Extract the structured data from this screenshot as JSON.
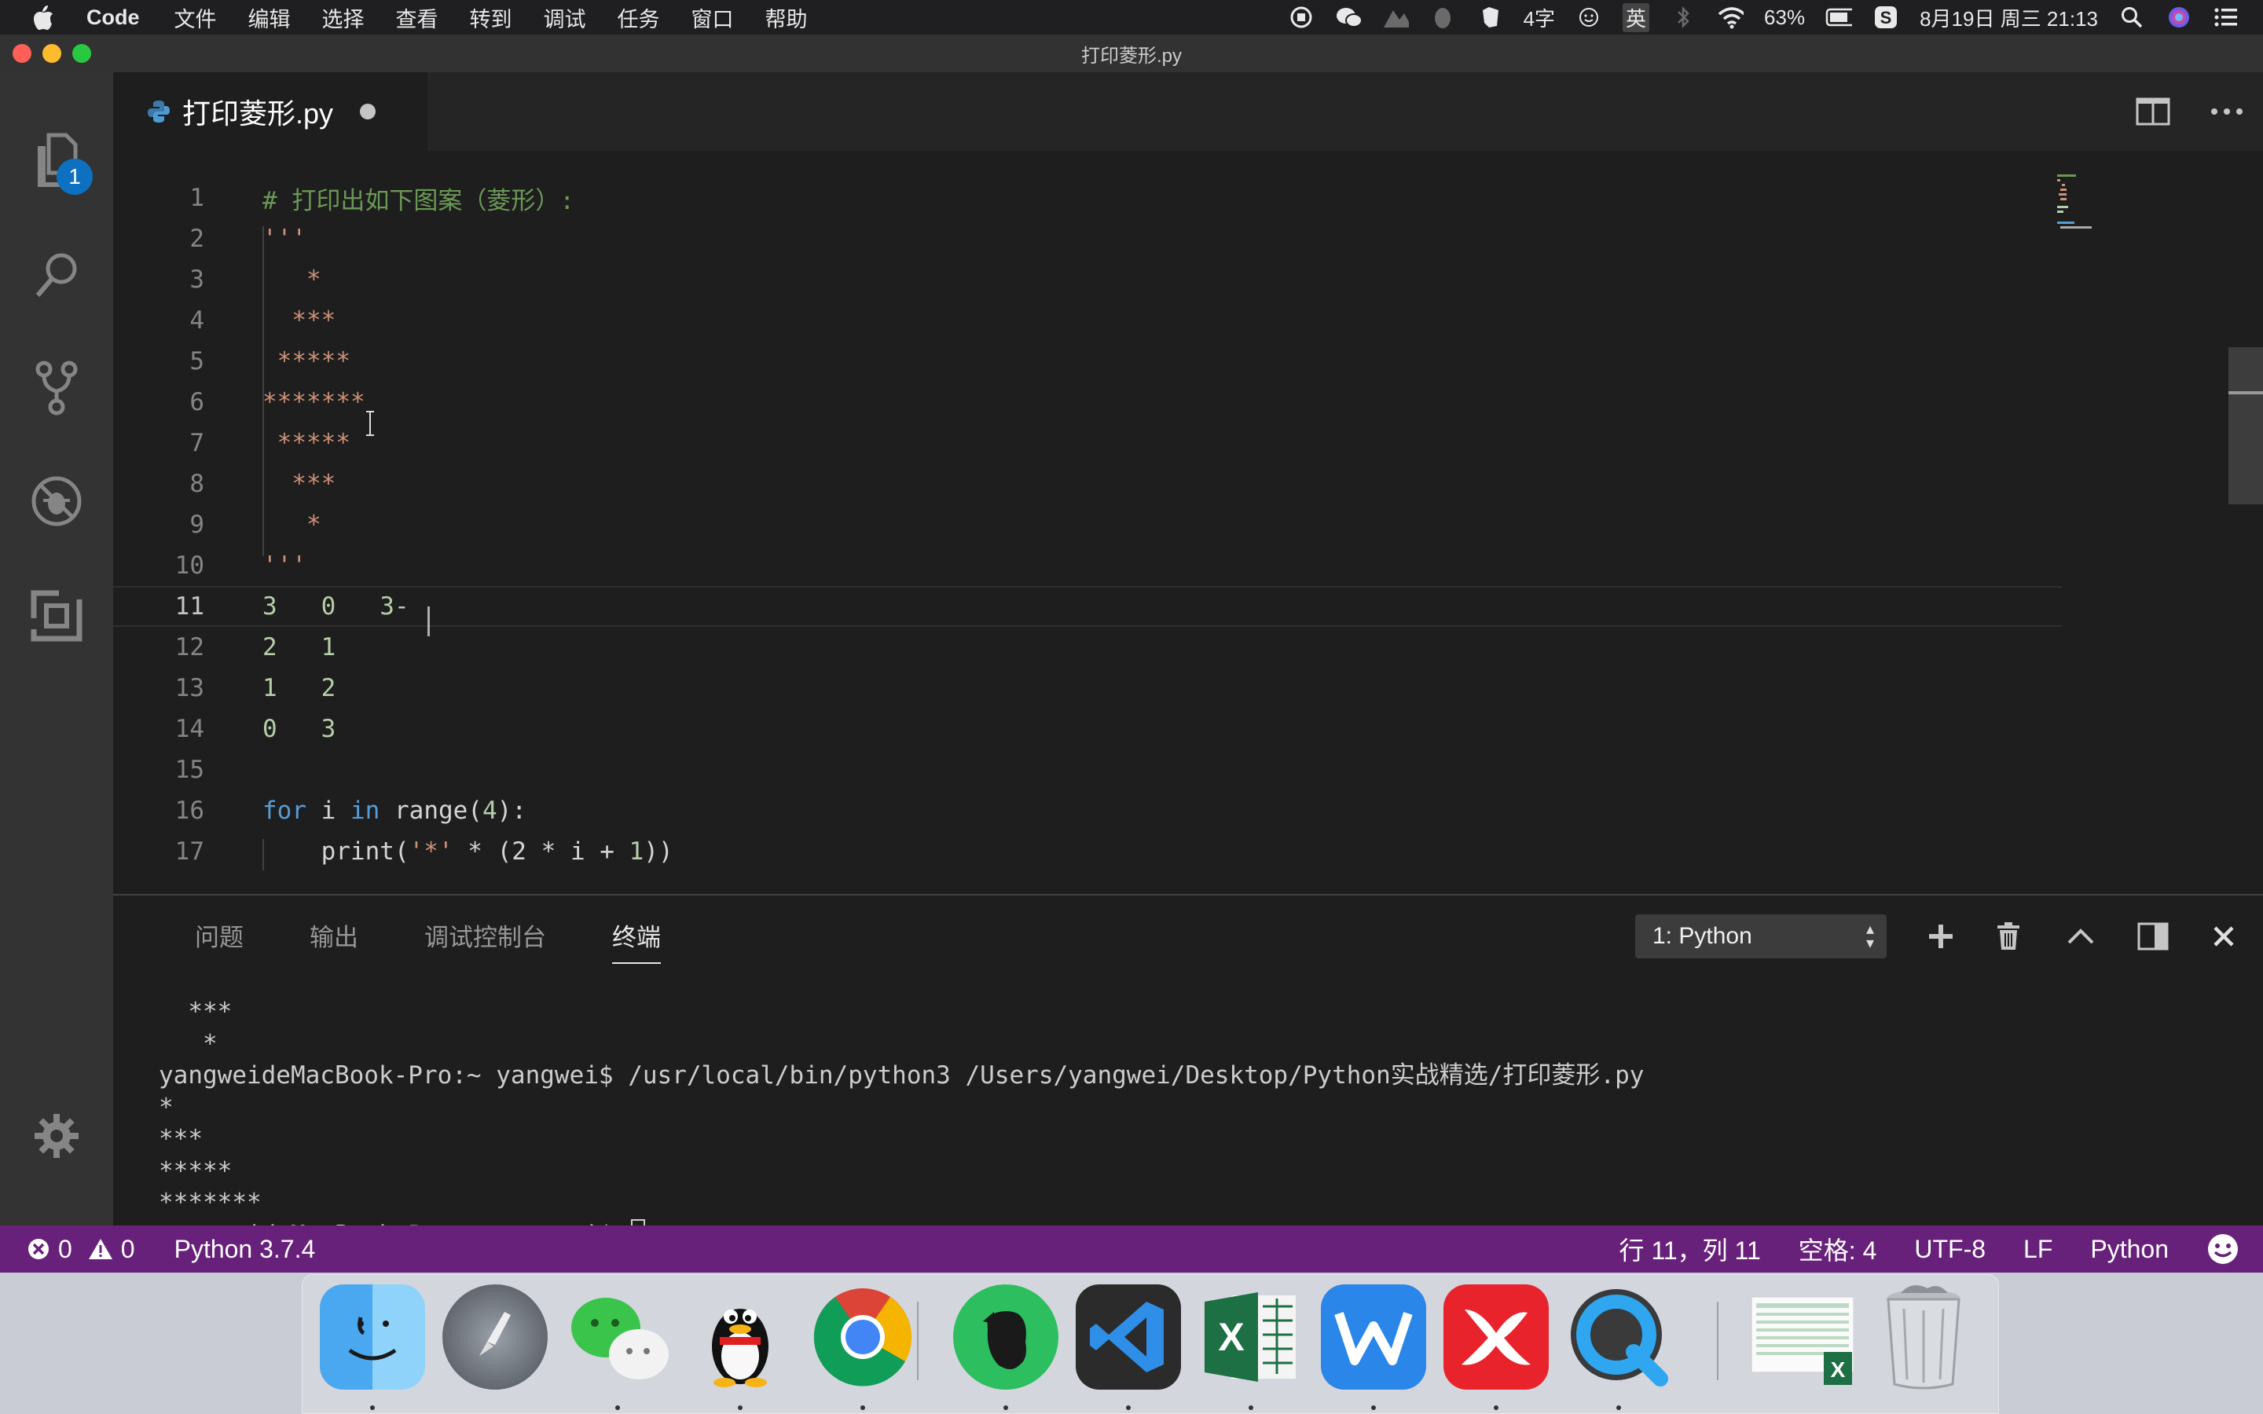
{
  "menubar": {
    "app": "Code",
    "menus": [
      "文件",
      "编辑",
      "选择",
      "查看",
      "转到",
      "调试",
      "任务",
      "窗口",
      "帮助"
    ],
    "input_status": "4字",
    "input_lang": "英",
    "battery": "63%",
    "datetime": "8月19日 周三  21:13"
  },
  "window": {
    "title": "打印菱形.py"
  },
  "activity": {
    "explorer_badge": "1"
  },
  "tab": {
    "filename": "打印菱形.py"
  },
  "editor": {
    "lines": [
      {
        "n": "1",
        "text": "# 打印出如下图案（菱形）:"
      },
      {
        "n": "2",
        "text": "'''"
      },
      {
        "n": "3",
        "text": "   *"
      },
      {
        "n": "4",
        "text": "  ***"
      },
      {
        "n": "5",
        "text": " *****"
      },
      {
        "n": "6",
        "text": "*******"
      },
      {
        "n": "7",
        "text": " *****"
      },
      {
        "n": "8",
        "text": "  ***"
      },
      {
        "n": "9",
        "text": "   *"
      },
      {
        "n": "10",
        "text": "'''"
      },
      {
        "n": "11",
        "text": "3   0   3-"
      },
      {
        "n": "12",
        "text": "2   1"
      },
      {
        "n": "13",
        "text": "1   2"
      },
      {
        "n": "14",
        "text": "0   3"
      },
      {
        "n": "15",
        "text": ""
      },
      {
        "n": "16",
        "kw1": "for",
        "mid1": " i ",
        "kw2": "in",
        "mid2": " range(",
        "num": "4",
        "end": "):"
      },
      {
        "n": "17",
        "pre": "    print(",
        "str": "'*'",
        "mid": " * (2 * i + ",
        "num": "1",
        "end": "))"
      }
    ]
  },
  "panel": {
    "tabs": [
      "问题",
      "输出",
      "调试控制台",
      "终端"
    ],
    "active_tab": "终端",
    "terminal_select": "1: Python",
    "terminal_lines": [
      "  ***",
      "   *",
      "yangweideMacBook-Pro:~ yangwei$ /usr/local/bin/python3 /Users/yangwei/Desktop/Python实战精选/打印菱形.py",
      "*",
      "***",
      "*****",
      "*******"
    ],
    "prompt": "yangweideMacBook-Pro:~ yangwei$ "
  },
  "statusbar": {
    "errors": "0",
    "warnings": "0",
    "interpreter": "Python 3.7.4",
    "position": "行 11，列 11",
    "spaces": "空格: 4",
    "encoding": "UTF-8",
    "eol": "LF",
    "language": "Python"
  },
  "colors": {
    "statusbar": "#68217a",
    "editor_bg": "#1e1e1e",
    "comment": "#6a9955",
    "string": "#ce9178",
    "number": "#b5cea8",
    "keyword": "#569cd6"
  },
  "dock": {
    "apps": [
      "finder-icon",
      "launchpad-icon",
      "wechat-icon",
      "qq-icon",
      "chrome-icon",
      "evernote-icon",
      "vscode-icon",
      "excel-icon",
      "wps-icon",
      "xmind-icon",
      "quicktime-icon",
      "excel-document-icon",
      "trash-icon"
    ]
  }
}
